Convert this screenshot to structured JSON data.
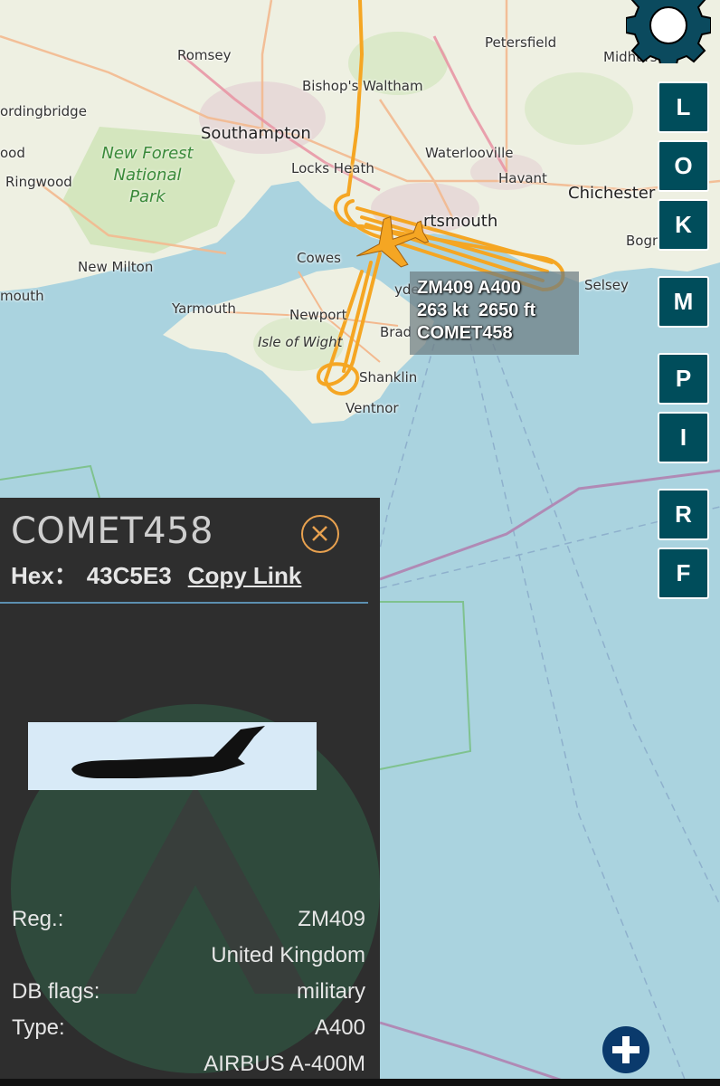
{
  "map": {
    "places": {
      "romsey": "Romsey",
      "bishops_waltham": "Bishop's Waltham",
      "petersfield": "Petersfield",
      "midhurst": "Midhurs",
      "fordingbridge": "ordingbridge",
      "southampton": "Southampton",
      "wood": "ood",
      "waterlooville": "Waterlooville",
      "ringwood": "Ringwood",
      "locks_heath": "Locks Heath",
      "havant": "Havant",
      "chichester": "Chichester",
      "portsmouth": "rtsmouth",
      "bognor": "Bogn",
      "new_milton": "New Milton",
      "cowes": "Cowes",
      "selsey": "Selsey",
      "lymouth": "mouth",
      "ryde": "yde",
      "yarmouth": "Yarmouth",
      "newport": "Newport",
      "brading": "Brad",
      "shanklin": "Shanklin",
      "ventnor": "Ventnor"
    },
    "new_forest_lines": [
      "New Forest",
      "National",
      "Park"
    ],
    "isle_of_wight": "Isle of Wight",
    "track_color": "#f5a623"
  },
  "aircraft_label": {
    "line1": "ZM409 A400",
    "line2": "263 kt  2650 ft",
    "line3": "COMET458"
  },
  "side_buttons": [
    "L",
    "O",
    "K",
    "M",
    "P",
    "I",
    "R",
    "F"
  ],
  "settings_icon": "gear-icon",
  "zoom_icon": "plus-icon",
  "panel": {
    "title": "COMET458",
    "hex_label": "Hex：",
    "hex_value": "43C5E3",
    "copy_link": "Copy Link",
    "reg_label": "Reg.:",
    "reg_value": "ZM409",
    "country": "United Kingdom",
    "db_flags_label": "DB flags:",
    "db_flags_value": "military",
    "type_label": "Type:",
    "type_value": "A400",
    "type_full": "AIRBUS A-400M"
  },
  "colors": {
    "button_bg": "#004d5b",
    "accent_orange": "#e8a14f",
    "panel_bg": "#2e2e2e",
    "sea": "#aad3df"
  }
}
